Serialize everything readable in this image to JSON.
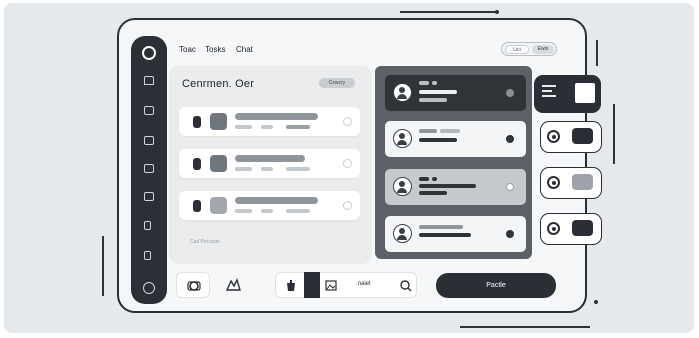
{
  "top_tabs": [
    "Toac",
    "Tosks",
    "Chat"
  ],
  "header_pills": {
    "left": "Lici",
    "right": "Ewin"
  },
  "panel": {
    "title": "Cenrmen. Oer",
    "tag": "Cxwcry"
  },
  "footer_text": "Cad Procssin",
  "search": {
    "value": ".naiet"
  },
  "primary_button": "Pactle",
  "icons": {
    "logo": "circle-logo-icon",
    "search": "search-icon",
    "avatar": "user-avatar-icon"
  },
  "colors": {
    "dark": "#2b2f35",
    "panel": "#5b6167",
    "background": "#e5e9ec"
  }
}
